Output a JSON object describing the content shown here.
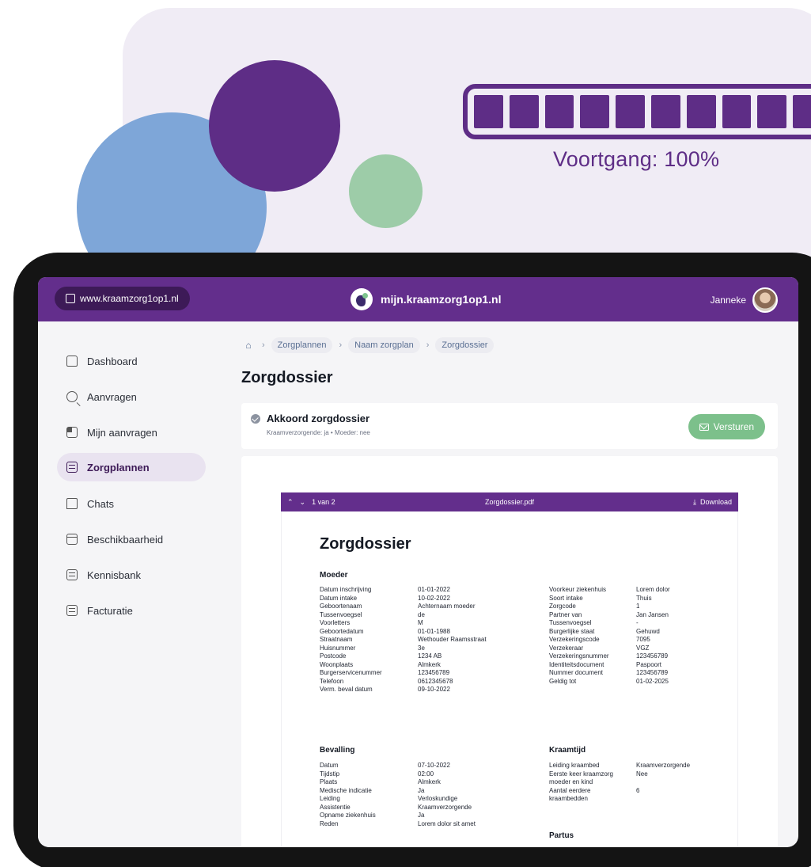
{
  "progress": {
    "label": "Voortgang: 100%",
    "value": 1.0,
    "segments": 10
  },
  "topbar": {
    "site_link": "www.kraamzorg1op1.nl",
    "brand": "mijn.kraamzorg1op1.nl",
    "user_name": "Janneke"
  },
  "sidebar": {
    "items": [
      {
        "label": "Dashboard",
        "icon": "home-icon"
      },
      {
        "label": "Aanvragen",
        "icon": "search-icon"
      },
      {
        "label": "Mijn aanvragen",
        "icon": "grid-icon"
      },
      {
        "label": "Zorgplannen",
        "icon": "list-icon",
        "active": true
      },
      {
        "label": "Chats",
        "icon": "chat-icon"
      },
      {
        "label": "Beschikbaarheid",
        "icon": "calendar-icon"
      },
      {
        "label": "Kennisbank",
        "icon": "book-icon"
      },
      {
        "label": "Facturatie",
        "icon": "invoice-icon"
      }
    ]
  },
  "breadcrumbs": [
    "Zorgplannen",
    "Naam zorgplan",
    "Zorgdossier"
  ],
  "page": {
    "title": "Zorgdossier"
  },
  "approval": {
    "title": "Akkoord zorgdossier",
    "subtitle": "Kraamverzorgende: ja • Moeder: nee",
    "send_label": "Versturen"
  },
  "viewer": {
    "page_indicator": "1 van 2",
    "file_name": "Zorgdossier.pdf",
    "download_label": "Download"
  },
  "document": {
    "title": "Zorgdossier",
    "sections": {
      "moeder": "Moeder",
      "bevalling": "Bevalling",
      "kraamtijd": "Kraamtijd",
      "partus": "Partus"
    },
    "moeder_left": [
      [
        "Datum inschrijving",
        "01-01-2022"
      ],
      [
        "Datum intake",
        "10-02-2022"
      ],
      [
        "Geboortenaam",
        "Achternaam moeder"
      ],
      [
        "Tussenvoegsel",
        "de"
      ],
      [
        "Voorletters",
        "M"
      ],
      [
        "Geboortedatum",
        "01-01-1988"
      ],
      [
        "Straatnaam",
        "Wethouder Raamsstraat"
      ],
      [
        "Huisnummer",
        "3e"
      ],
      [
        "Postcode",
        "1234 AB"
      ],
      [
        "Woonplaats",
        "Almkerk"
      ],
      [
        "Burgerservicenummer",
        "123456789"
      ],
      [
        "Telefoon",
        "0612345678"
      ],
      [
        "Verm. beval datum",
        "09-10-2022"
      ]
    ],
    "moeder_right": [
      [
        "Voorkeur ziekenhuis",
        "Lorem dolor"
      ],
      [
        "Soort intake",
        "Thuis"
      ],
      [
        "Zorgcode",
        "1"
      ],
      [
        "Partner van",
        "Jan Jansen"
      ],
      [
        "Tussenvoegsel",
        "-"
      ],
      [
        "Burgerlijke staat",
        "Gehuwd"
      ],
      [
        "Verzekeringscode",
        "7095"
      ],
      [
        "Verzekeraar",
        "VGZ"
      ],
      [
        "Verzekeringsnummer",
        "123456789"
      ],
      [
        "Identiteitsdocument",
        "Paspoort"
      ],
      [
        "Nummer document",
        "123456789"
      ],
      [
        "Geldig tot",
        "01-02-2025"
      ]
    ],
    "bevalling": [
      [
        "Datum",
        "07-10-2022"
      ],
      [
        "Tijdstip",
        "02:00"
      ],
      [
        "Plaats",
        "Almkerk"
      ],
      [
        "Medische indicatie",
        "Ja"
      ],
      [
        "Leiding",
        "Verloskundige"
      ],
      [
        "Assistentie",
        "Kraamverzorgende"
      ],
      [
        "Opname ziekenhuis",
        "Ja"
      ],
      [
        "Reden",
        "Lorem dolor sit amet"
      ]
    ],
    "kraamtijd": [
      [
        "Leiding kraambed",
        "Kraamverzorgende"
      ],
      [
        "Eerste keer kraamzorg",
        "Nee"
      ],
      [
        "moeder en kind",
        ""
      ],
      [
        "Aantal eerdere",
        "6"
      ],
      [
        "kraambedden",
        ""
      ]
    ]
  }
}
